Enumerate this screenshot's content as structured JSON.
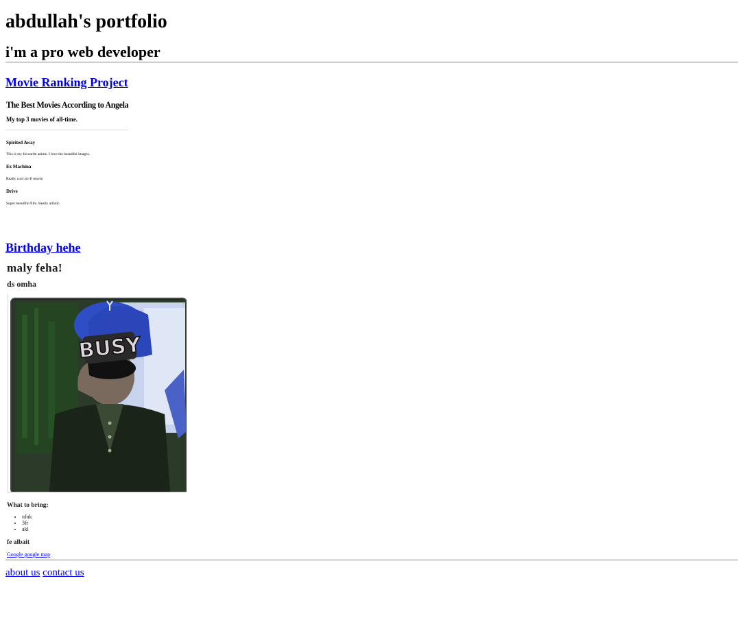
{
  "header": {
    "title": "abdullah's portfolio",
    "subtitle": "i'm a pro web developer"
  },
  "projects": [
    {
      "link_label": "Movie Ranking Project",
      "preview": {
        "title": "The Best Movies According to Angela",
        "subtitle": "My top 3 movies of all-time.",
        "movies": [
          {
            "name": "Spirited Away",
            "desc": "This is my favourite anime. I love the beautiful images."
          },
          {
            "name": "Ex Machina",
            "desc": "Really cool sci-fi movie."
          },
          {
            "name": "Drive",
            "desc": "Super beautiful film. Really artistic."
          }
        ]
      }
    },
    {
      "link_label": "Birthday hehe",
      "preview": {
        "title": "maly feha!",
        "subtitle": "ds omha",
        "photo_icon": "busy-cap-photo",
        "photo_cap_text": "BUSY",
        "bring_title": "What to bring:",
        "bring_items": [
          "nfnk",
          "3fr",
          "akl"
        ],
        "location_title": "fe albait",
        "map_link": "Google google map"
      }
    }
  ],
  "footer": {
    "about_label": "about us",
    "contact_label": "contact us"
  },
  "colors": {
    "link": "#0000ee",
    "divider": "#808080"
  }
}
